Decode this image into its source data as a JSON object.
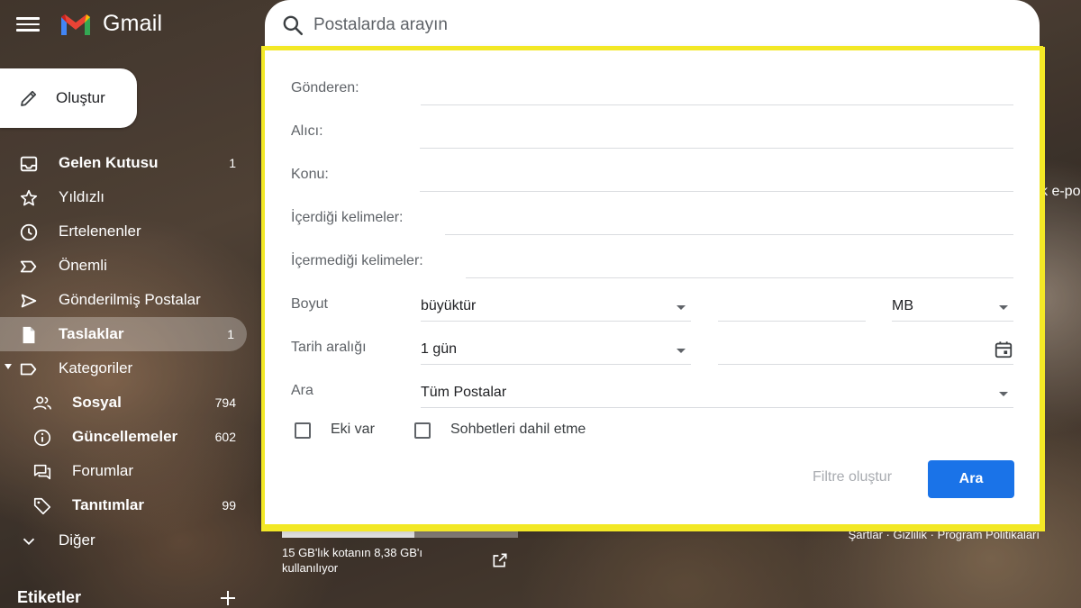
{
  "app": {
    "name": "Gmail"
  },
  "search": {
    "placeholder": "Postalarda arayın"
  },
  "compose": {
    "label": "Oluştur"
  },
  "sidebar": {
    "items": [
      {
        "label": "Gelen Kutusu",
        "count": "1",
        "icon": "inbox-icon"
      },
      {
        "label": "Yıldızlı",
        "count": "",
        "icon": "star-icon"
      },
      {
        "label": "Ertelenenler",
        "count": "",
        "icon": "clock-icon"
      },
      {
        "label": "Önemli",
        "count": "",
        "icon": "important-icon"
      },
      {
        "label": "Gönderilmiş Postalar",
        "count": "",
        "icon": "send-icon"
      },
      {
        "label": "Taslaklar",
        "count": "1",
        "icon": "draft-icon"
      },
      {
        "label": "Kategoriler",
        "count": "",
        "icon": "label-icon"
      },
      {
        "label": "Sosyal",
        "count": "794",
        "icon": "people-icon"
      },
      {
        "label": "Güncellemeler",
        "count": "602",
        "icon": "info-icon"
      },
      {
        "label": "Forumlar",
        "count": "",
        "icon": "forum-icon"
      },
      {
        "label": "Tanıtımlar",
        "count": "99",
        "icon": "tag-icon"
      },
      {
        "label": "Diğer",
        "count": "",
        "icon": "chevron-down-icon"
      }
    ],
    "labels_heading": "Etiketler"
  },
  "advanced_search": {
    "from_label": "Gönderen:",
    "to_label": "Alıcı:",
    "subject_label": "Konu:",
    "has_words_label": "İçerdiği kelimeler:",
    "not_words_label": "İçermediği kelimeler:",
    "size_label": "Boyut",
    "size_op": "büyüktür",
    "size_unit": "MB",
    "date_label": "Tarih aralığı",
    "date_range": "1 gün",
    "search_in_label": "Ara",
    "search_in": "Tüm Postalar",
    "has_attachment": "Eki var",
    "exclude_chats": "Sohbetleri dahil etme",
    "create_filter": "Filtre oluştur",
    "search_button": "Ara"
  },
  "footer": {
    "storage_text": "15 GB'lık kotanın 8,38 GB'ı kullanılıyor",
    "storage_fraction": 0.56,
    "links": "Şartlar · Gizlilik · Program Politikaları"
  },
  "peek_text": "k e-po",
  "colors": {
    "accent": "#1a73e8",
    "highlight": "#f3e826"
  }
}
